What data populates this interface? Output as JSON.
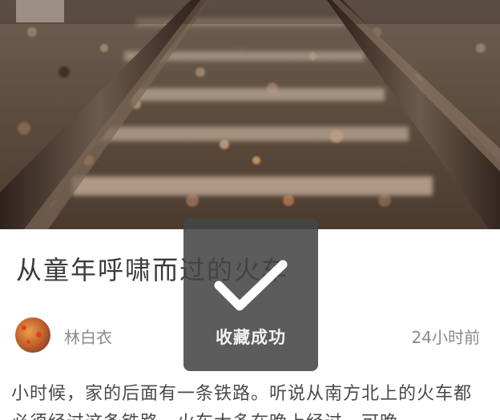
{
  "article": {
    "title": "从童年呼啸而过的火车",
    "author": "林白衣",
    "time_ago": "24小时前",
    "body": "小时候，家的后面有一条铁路。听说从南方北上的火车都必须经过这条铁路，火车大多在晚上经过，可晚"
  },
  "toast": {
    "label": "收藏成功",
    "icon": "checkmark-icon"
  },
  "hero": {
    "icon": "railroad-tracks-photo"
  },
  "colors": {
    "title": "#3a3a3a",
    "meta": "#8a8a8a",
    "body": "#4a4a4a",
    "toast_bg": "#464646",
    "toast_text": "#f2f2f2"
  }
}
